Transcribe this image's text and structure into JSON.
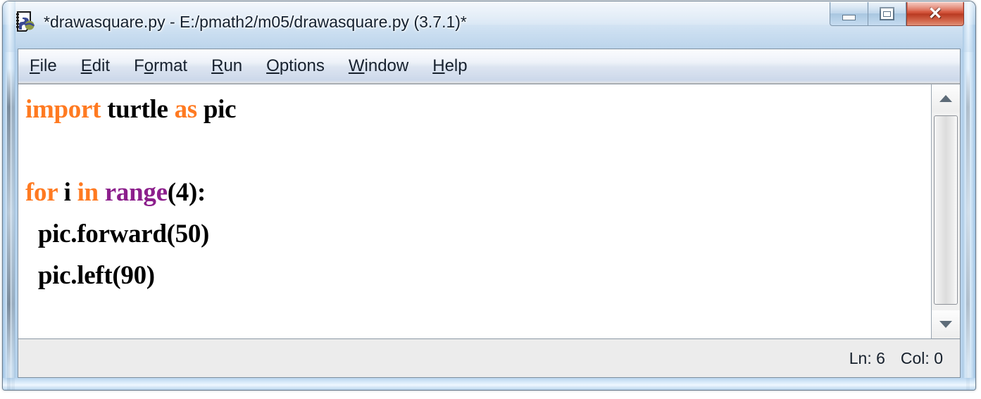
{
  "window": {
    "title": "*drawasquare.py - E:/pmath2/m05/drawasquare.py (3.7.1)*",
    "icon": "python-idle-file-icon",
    "controls": {
      "minimize": "minimize-icon",
      "maximize": "maximize-icon",
      "close": "✕"
    },
    "accent_close_color": "#bf3a22",
    "frame_color": "#c3d9ee"
  },
  "menu": {
    "items": [
      {
        "label": "File",
        "mnemonic": "F"
      },
      {
        "label": "Edit",
        "mnemonic": "E"
      },
      {
        "label": "Format",
        "mnemonic": "o"
      },
      {
        "label": "Run",
        "mnemonic": "R"
      },
      {
        "label": "Options",
        "mnemonic": "O"
      },
      {
        "label": "Window",
        "mnemonic": "W"
      },
      {
        "label": "Help",
        "mnemonic": "H"
      }
    ]
  },
  "editor": {
    "colors": {
      "keyword": "#ff7a21",
      "builtin": "#8c1f8c",
      "text": "#000000",
      "background": "#ffffff"
    },
    "lines": [
      {
        "n": 1,
        "tokens": [
          {
            "t": "import",
            "c": "kw"
          },
          {
            "t": " turtle ",
            "c": "plain"
          },
          {
            "t": "as",
            "c": "kw"
          },
          {
            "t": " pic",
            "c": "plain"
          }
        ]
      },
      {
        "n": 2,
        "tokens": []
      },
      {
        "n": 3,
        "tokens": [
          {
            "t": "for",
            "c": "kw"
          },
          {
            "t": " i ",
            "c": "plain"
          },
          {
            "t": "in",
            "c": "kw"
          },
          {
            "t": " ",
            "c": "plain"
          },
          {
            "t": "range",
            "c": "blt"
          },
          {
            "t": "(4):",
            "c": "plain"
          }
        ]
      },
      {
        "n": 4,
        "tokens": [
          {
            "t": "  pic.forward(50)",
            "c": "plain"
          }
        ]
      },
      {
        "n": 5,
        "tokens": [
          {
            "t": "  pic.left(90)",
            "c": "plain"
          }
        ]
      }
    ]
  },
  "scrollbar": {
    "up_arrow": "scroll-up-icon",
    "down_arrow": "scroll-down-icon"
  },
  "status": {
    "line": "Ln: 6",
    "column": "Col: 0"
  }
}
